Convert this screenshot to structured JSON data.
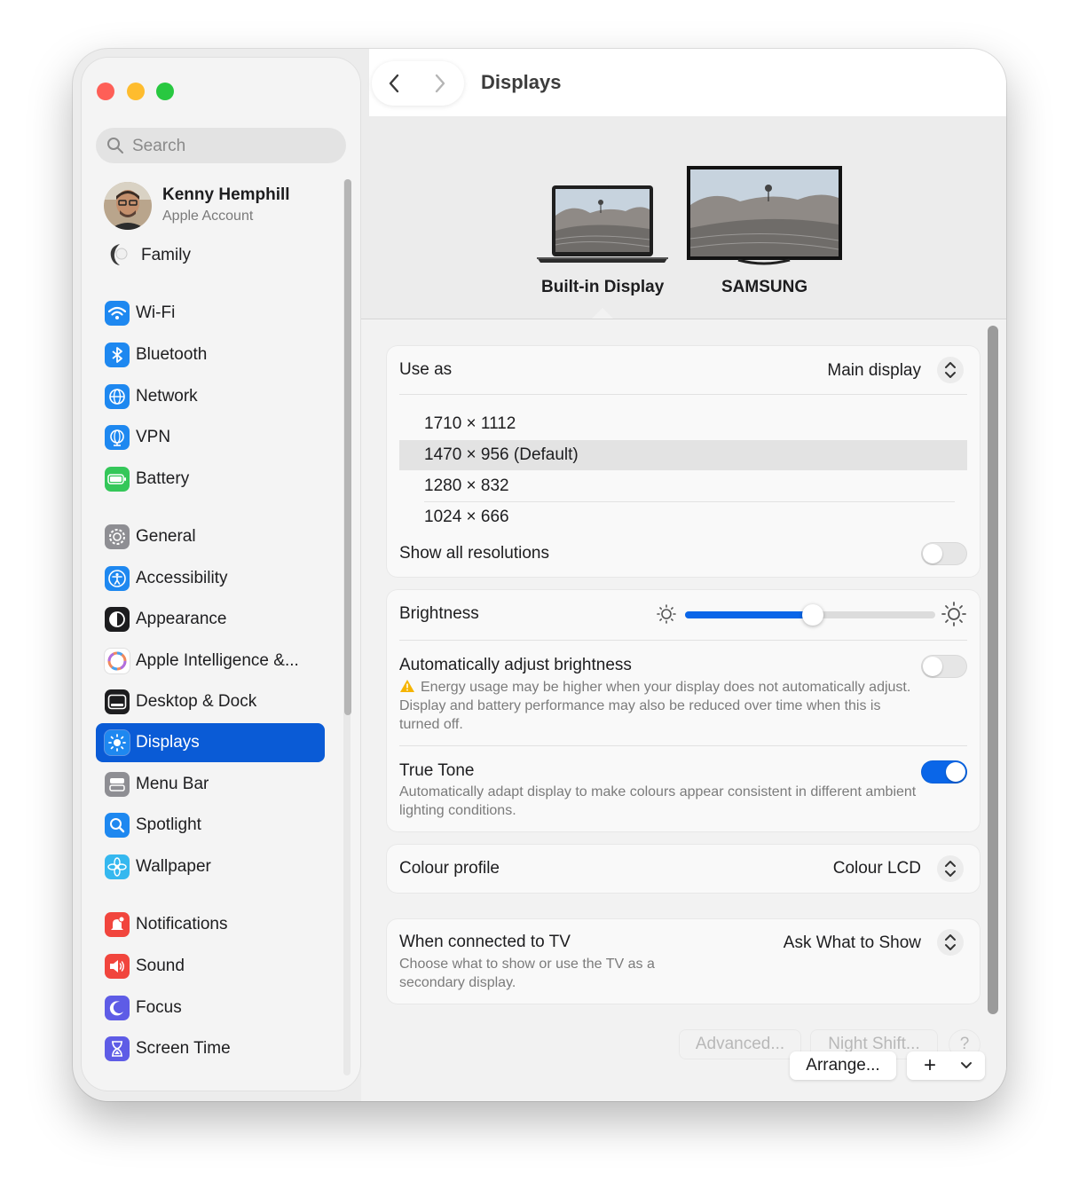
{
  "window": {
    "title": "Displays"
  },
  "sidebar": {
    "search_placeholder": "Search",
    "profile": {
      "name": "Kenny Hemphill",
      "subtitle": "Apple Account"
    },
    "family_label": "Family",
    "items": [
      {
        "label": "Wi-Fi",
        "icon": "wifi-icon",
        "color": "#1e88f0"
      },
      {
        "label": "Bluetooth",
        "icon": "bluetooth-icon",
        "color": "#1e88f0"
      },
      {
        "label": "Network",
        "icon": "globe-icon",
        "color": "#1e88f0"
      },
      {
        "label": "VPN",
        "icon": "vpn-globe-icon",
        "color": "#1e88f0"
      },
      {
        "label": "Battery",
        "icon": "battery-icon",
        "color": "#34c759"
      },
      {
        "label": "General",
        "icon": "gear-icon",
        "color": "#8e8e93"
      },
      {
        "label": "Accessibility",
        "icon": "accessibility-icon",
        "color": "#1e88f0"
      },
      {
        "label": "Appearance",
        "icon": "appearance-icon",
        "color": "#1d1d1f"
      },
      {
        "label": "Apple Intelligence &...",
        "icon": "apple-intelligence-icon",
        "color": "#f08a5d"
      },
      {
        "label": "Desktop & Dock",
        "icon": "dock-icon",
        "color": "#1d1d1f"
      },
      {
        "label": "Displays",
        "icon": "sun-icon",
        "color": "#1e88f0"
      },
      {
        "label": "Menu Bar",
        "icon": "menu-bar-icon",
        "color": "#8e8e93"
      },
      {
        "label": "Spotlight",
        "icon": "magnifier-icon",
        "color": "#1e88f0"
      },
      {
        "label": "Wallpaper",
        "icon": "flower-icon",
        "color": "#35b8ef"
      },
      {
        "label": "Notifications",
        "icon": "bell-icon",
        "color": "#f1453d"
      },
      {
        "label": "Sound",
        "icon": "speaker-icon",
        "color": "#f1453d"
      },
      {
        "label": "Focus",
        "icon": "moon-icon",
        "color": "#5e5ce6"
      },
      {
        "label": "Screen Time",
        "icon": "hourglass-icon",
        "color": "#5e5ce6"
      }
    ]
  },
  "displays": {
    "builtin_label": "Built-in Display",
    "external_label": "SAMSUNG"
  },
  "settings": {
    "use_as": {
      "label": "Use as",
      "value": "Main display"
    },
    "resolutions": [
      "1710 × 1112",
      "1470 × 956 (Default)",
      "1280 × 832",
      "1024 × 666"
    ],
    "selected_resolution": "1470 × 956 (Default)",
    "show_all_label": "Show all resolutions",
    "show_all_on": false,
    "brightness": {
      "label": "Brightness",
      "level": 0.51
    },
    "auto_brightness": {
      "label": "Automatically adjust brightness",
      "warning": "Energy usage may be higher when your display does not automatically adjust. Display and battery performance may also be reduced over time when this is turned off.",
      "on": false
    },
    "true_tone": {
      "label": "True Tone",
      "description": "Automatically adapt display to make colours appear consistent in different ambient lighting conditions.",
      "on": true
    },
    "colour_profile": {
      "label": "Colour profile",
      "value": "Colour LCD"
    },
    "tv": {
      "label": "When connected to TV",
      "description": "Choose what to show or use the TV as a secondary display.",
      "value": "Ask What to Show"
    }
  },
  "buttons": {
    "advanced": "Advanced...",
    "night_shift": "Night Shift...",
    "help": "?",
    "arrange": "Arrange...",
    "add": "+",
    "more": "⌄"
  },
  "colors": {
    "accent": "#0a5bd6",
    "toggle_on": "#0a66e8"
  }
}
